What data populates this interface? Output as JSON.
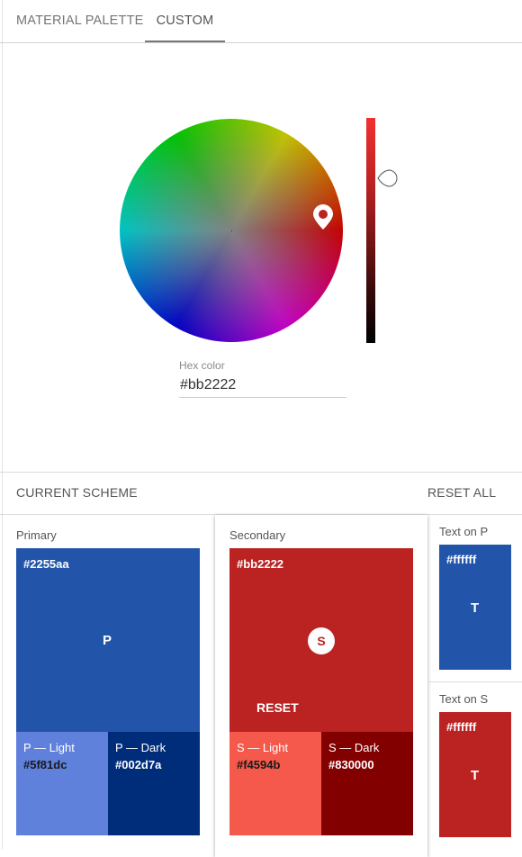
{
  "tabs": [
    {
      "label": "MATERIAL PALETTE"
    },
    {
      "label": "CUSTOM"
    }
  ],
  "picker": {
    "hex_label": "Hex color",
    "hex_value": "#bb2222"
  },
  "scheme": {
    "title": "CURRENT SCHEME",
    "reset_all": "RESET ALL"
  },
  "primary": {
    "label": "Primary",
    "hex": "#2255aa",
    "letter": "P",
    "light_label": "P — Light",
    "light_hex": "#5f81dc",
    "dark_label": "P — Dark",
    "dark_hex": "#002d7a"
  },
  "secondary": {
    "label": "Secondary",
    "hex": "#bb2222",
    "letter": "S",
    "reset": "RESET",
    "light_label": "S — Light",
    "light_hex": "#f4594b",
    "dark_label": "S — Dark",
    "dark_hex": "#830000"
  },
  "text_on_p": {
    "label": "Text on P",
    "hex": "#ffffff",
    "letter": "T"
  },
  "text_on_s": {
    "label": "Text on S",
    "hex": "#ffffff",
    "letter": "T"
  },
  "colors": {
    "primary": "#2255aa",
    "primary_light": "#5f81dc",
    "primary_dark": "#002d7a",
    "secondary": "#bb2222",
    "secondary_light": "#f4594b",
    "secondary_dark": "#830000"
  }
}
